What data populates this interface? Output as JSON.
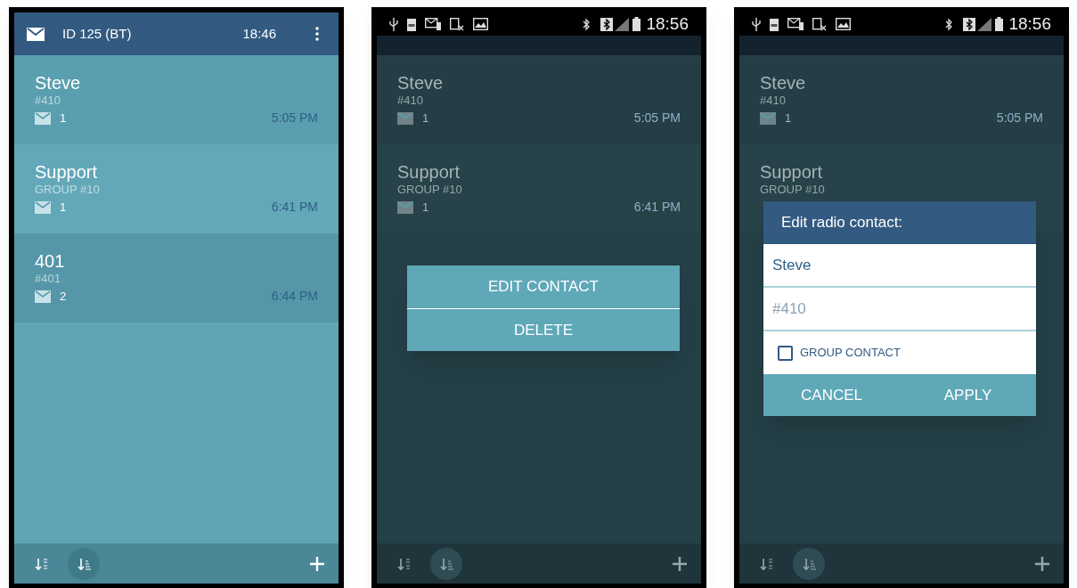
{
  "screens": [
    {
      "app_bar": {
        "title": "ID 125 (BT)",
        "time": "18:46"
      },
      "contacts": [
        {
          "name": "Steve",
          "number": "#410",
          "count": "1",
          "time": "5:05 PM"
        },
        {
          "name": "Support",
          "number": "GROUP #10",
          "count": "1",
          "time": "6:41 PM"
        },
        {
          "name": "401",
          "number": "#401",
          "count": "2",
          "time": "6:44 PM"
        }
      ],
      "sort_options": [
        {
          "kind": "alphabetical",
          "selected": false
        },
        {
          "kind": "recent",
          "selected": true
        }
      ]
    },
    {
      "status_bar": {
        "time": "18:56"
      },
      "contacts": [
        {
          "name": "Steve",
          "number": "#410",
          "count": "1",
          "time": "5:05 PM"
        },
        {
          "name": "Support",
          "number": "GROUP #10",
          "count": "1",
          "time": "6:41 PM"
        }
      ],
      "sort_options": [
        {
          "kind": "alphabetical",
          "selected": false
        },
        {
          "kind": "recent",
          "selected": true
        }
      ],
      "overlay": {
        "kind": "context_menu",
        "items": [
          "EDIT CONTACT",
          "DELETE"
        ]
      }
    },
    {
      "status_bar": {
        "time": "18:56"
      },
      "contacts": [
        {
          "name": "Steve",
          "number": "#410",
          "count": "1",
          "time": "5:05 PM"
        },
        {
          "name": "Support",
          "number": "GROUP #10"
        }
      ],
      "sort_options": [
        {
          "kind": "alphabetical",
          "selected": false
        },
        {
          "kind": "recent",
          "selected": true
        }
      ],
      "overlay": {
        "kind": "dialog",
        "title": "Edit radio contact:",
        "fields": [
          {
            "value": "Steve"
          },
          {
            "placeholder": "#410"
          }
        ],
        "checkbox": {
          "label": "GROUP CONTACT",
          "checked": false
        },
        "buttons": [
          "CANCEL",
          "APPLY"
        ]
      }
    }
  ]
}
